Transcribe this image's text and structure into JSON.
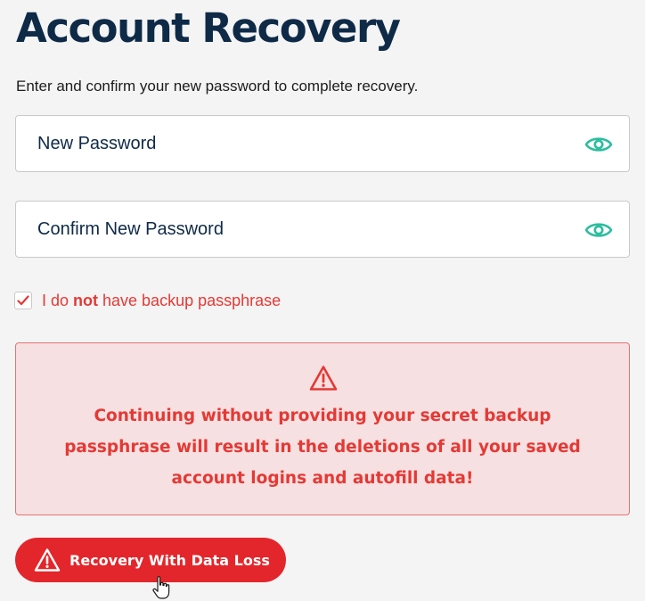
{
  "title": "Account Recovery",
  "subtitle": "Enter and confirm your new password to complete recovery.",
  "fields": {
    "new_password": {
      "placeholder": "New Password",
      "value": "",
      "icon": "eye-icon"
    },
    "confirm_password": {
      "placeholder": "Confirm New Password",
      "value": "",
      "icon": "eye-icon"
    }
  },
  "no_backup": {
    "checked": true,
    "label_prefix": "I do ",
    "label_bold": "not",
    "label_suffix": " have backup passphrase"
  },
  "alert": {
    "icon": "warning-icon",
    "message": "Continuing without providing your secret backup passphrase will result in the deletions of all your saved account logins and autofill data!"
  },
  "action_button": {
    "label": "Recovery With Data Loss",
    "icon": "warning-icon"
  },
  "colors": {
    "title": "#0e2a47",
    "accent_teal": "#2bbd9e",
    "danger": "#e3262b",
    "alert_bg": "#f6e0e1",
    "alert_text": "#e53935"
  }
}
